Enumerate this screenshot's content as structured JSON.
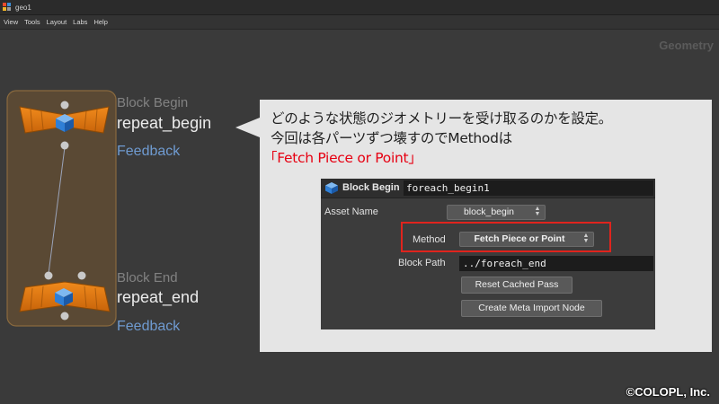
{
  "window": {
    "title": "geo1"
  },
  "menu": [
    "View",
    "Tools",
    "Layout",
    "Labs",
    "Help"
  ],
  "context": {
    "label": "Geometry"
  },
  "nodes": {
    "begin": {
      "type": "Block Begin",
      "name": "repeat_begin",
      "feedback": "Feedback"
    },
    "end": {
      "type": "Block End",
      "name": "repeat_end",
      "feedback": "Feedback"
    }
  },
  "note": {
    "line1": "どのような状態のジオメトリーを受け取るのかを設定。",
    "line2": "今回は各パーツずつ壊すのでMethodは",
    "line3": "「Fetch Piece or Point」"
  },
  "parm": {
    "node_type": "Block Begin",
    "node_name": "foreach_begin1",
    "asset_name_label": "Asset Name",
    "asset_name_value": "block_begin",
    "method_label": "Method",
    "method_value": "Fetch Piece or Point",
    "block_path_label": "Block Path",
    "block_path_value": "../foreach_end",
    "reset_button": "Reset Cached Pass",
    "create_button": "Create Meta Import Node"
  },
  "copyright": "©COLOPL, Inc.",
  "colors": {
    "node_orange": "#e07a10",
    "node_blue": "#2f7fd6",
    "highlight_red": "#e0241d",
    "note_red": "#e60012",
    "feedback_blue": "#6f9bd1"
  }
}
